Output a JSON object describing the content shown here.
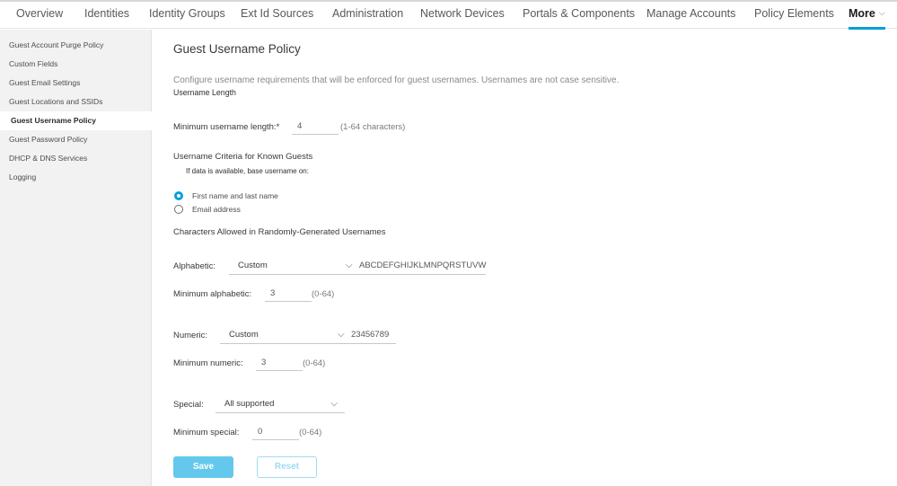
{
  "topnav": {
    "tabs": [
      {
        "label": "Overview"
      },
      {
        "label": "Identities"
      },
      {
        "label": "Identity Groups"
      },
      {
        "label": "Ext Id Sources"
      },
      {
        "label": "Administration"
      },
      {
        "label": "Network Devices"
      },
      {
        "label": "Portals & Components"
      },
      {
        "label": "Manage Accounts"
      },
      {
        "label": "Policy Elements"
      },
      {
        "label": "More",
        "active": true
      }
    ],
    "more_chevron": "⌵"
  },
  "sidebar": {
    "items": [
      {
        "label": "Guest Account Purge Policy"
      },
      {
        "label": "Custom Fields"
      },
      {
        "label": "Guest Email Settings"
      },
      {
        "label": "Guest Locations and SSIDs"
      },
      {
        "label": "Guest Username Policy",
        "active": true
      },
      {
        "label": "Guest Password Policy"
      },
      {
        "label": "DHCP & DNS Services"
      },
      {
        "label": "Logging"
      }
    ]
  },
  "main": {
    "title": "Guest Username Policy",
    "description": "Configure username requirements that will be enforced for guest usernames. Usernames are not case sensitive.",
    "length_section": "Username Length",
    "min_length": {
      "label": "Minimum username length:*",
      "value": "4",
      "hint": "(1-64 characters)"
    },
    "criteria_section": "Username Criteria for Known Guests",
    "criteria_sub": "If data is available, base username on:",
    "criteria_options": [
      {
        "label": "First name and last name",
        "checked": true
      },
      {
        "label": "Email address",
        "checked": false
      }
    ],
    "chars_section": "Characters Allowed in Randomly-Generated Usernames",
    "alphabetic": {
      "label": "Alphabetic:",
      "selected": "Custom",
      "chars": "ABCDEFGHIJKLMNPQRSTUVW",
      "min_label": "Minimum alphabetic:",
      "min_value": "3",
      "min_hint": "(0-64)"
    },
    "numeric": {
      "label": "Numeric:",
      "selected": "Custom",
      "chars": "23456789",
      "min_label": "Minimum numeric:",
      "min_value": "3",
      "min_hint": "(0-64)"
    },
    "special": {
      "label": "Special:",
      "selected": "All supported",
      "min_label": "Minimum special:",
      "min_value": "0",
      "min_hint": "(0-64)"
    },
    "chevron": "⌵",
    "buttons": {
      "save": "Save",
      "reset": "Reset"
    }
  },
  "colors": {
    "accent": "#049fd9",
    "save_bg": "#64c8ec",
    "reset_border": "#9edcf2"
  }
}
